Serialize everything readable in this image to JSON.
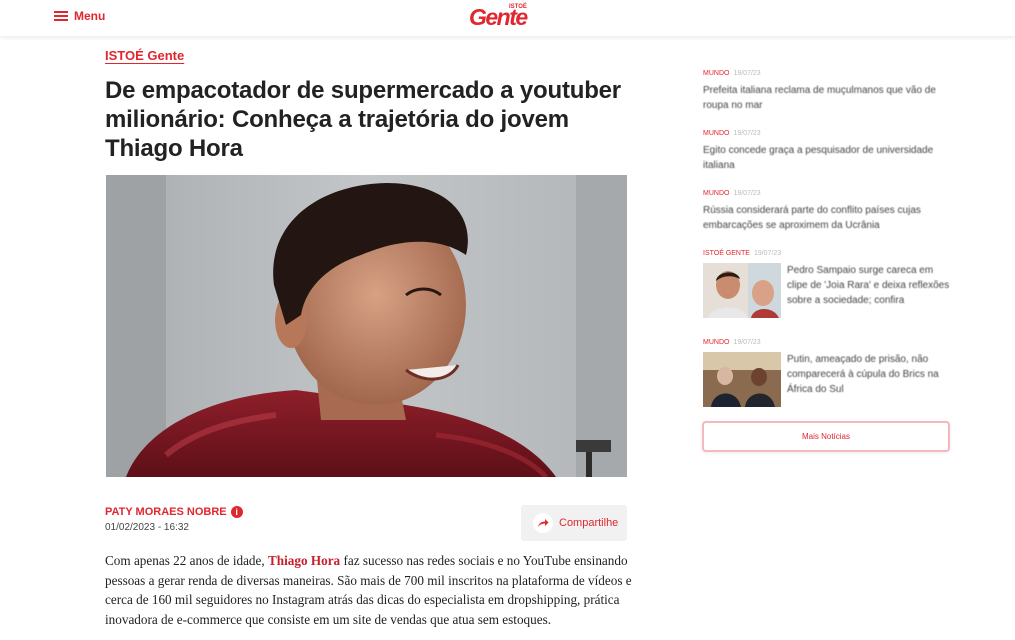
{
  "header": {
    "menu_label": "Menu",
    "logo_main": "Gente",
    "logo_small": "ISTOÉ"
  },
  "article": {
    "category": "ISTOÉ Gente",
    "title": "De empacotador de supermercado a youtuber milionário: Conheça a trajetória do jovem Thiago Hora",
    "author": "PATY MORAES NOBRE",
    "date": "01/02/2023 - 16:32",
    "share_label": "Compartilhe",
    "body_before": "Com apenas 22 anos de idade, ",
    "body_highlight": "Thiago Hora",
    "body_after": " faz sucesso nas redes sociais e no YouTube ensinando pessoas a gerar renda de diversas maneiras. São mais de 700 mil inscritos na plataforma de vídeos e cerca de 160 mil seguidores no Instagram atrás das dicas do especialista em dropshipping, prática inovadora de e-commerce que consiste em um site de vendas que atua sem estoques."
  },
  "sidebar": {
    "items": [
      {
        "category": "MUNDO",
        "date": "19/07/23",
        "title": "Prefeita italiana reclama de muçulmanos que vão de roupa no mar"
      },
      {
        "category": "MUNDO",
        "date": "19/07/23",
        "title": "Egito concede graça a pesquisador de universidade italiana"
      },
      {
        "category": "MUNDO",
        "date": "19/07/23",
        "title": "Rússia considerará parte do conflito países cujas embarcações se aproximem da Ucrânia"
      },
      {
        "category": "ISTOÉ GENTE",
        "date": "19/07/23",
        "title": "Pedro Sampaio surge careca em clipe de 'Joia Rara' e deixa reflexões sobre a sociedade; confira"
      },
      {
        "category": "MUNDO",
        "date": "19/07/23",
        "title": "Putin, ameaçado de prisão, não comparecerá à cúpula do Brics na África do Sul"
      }
    ],
    "more_label": "Mais Notícias"
  },
  "colors": {
    "accent": "#e0262e",
    "share_bg": "#f1f1f1"
  }
}
